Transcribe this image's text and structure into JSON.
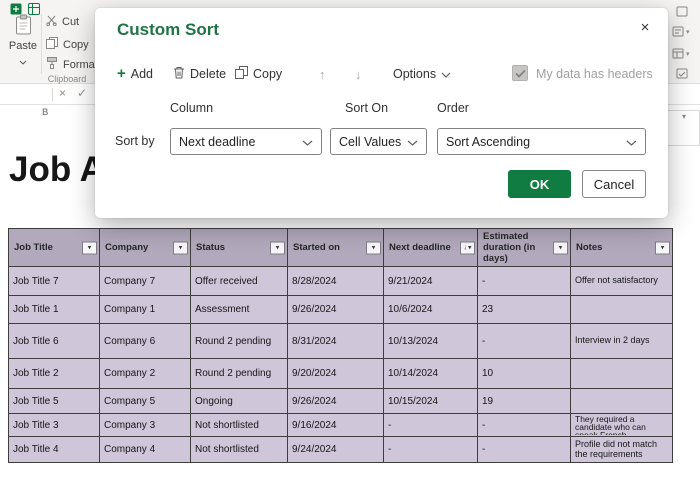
{
  "colors": {
    "accent": "#107c41",
    "title_green": "#217346",
    "header_bg": "#b2a9bc",
    "body_bg": "#cfc6d9",
    "grid": "#3e3e3e",
    "status_offer_bg": "#7aa33f",
    "status_assessment_bg": "#2e9ad5",
    "status_pending_bg": "#e0b62b",
    "status_pending_text": "#9c6500",
    "status_ongoing_text": "#4c8a2e",
    "status_rejected_text": "#c00000"
  },
  "icons": {
    "caret_down": "▾",
    "sort_down_arrow": "↓",
    "close": "×",
    "x_mark": "×",
    "check_mark": "✓",
    "up_arrow": "↑",
    "down_arrow": "↓",
    "plus": "+"
  },
  "ribbon": {
    "paste_label": "Paste",
    "cut_label": "Cut",
    "copy_label": "Copy",
    "format_label": "Format",
    "group_label": "Clipboard"
  },
  "sheet": {
    "title": "Job A",
    "column_letter": "B"
  },
  "dialog": {
    "title": "Custom Sort",
    "toolbar": {
      "add": "Add",
      "delete": "Delete",
      "copy": "Copy",
      "options": "Options",
      "headers_checkbox_label": "My data has headers",
      "headers_checkbox_checked": true
    },
    "labels": {
      "column": "Column",
      "sort_on": "Sort On",
      "order": "Order",
      "sort_by": "Sort by"
    },
    "selects": {
      "column_value": "Next deadline",
      "sort_on_value": "Cell Values",
      "order_value": "Sort Ascending"
    },
    "buttons": {
      "ok": "OK",
      "cancel": "Cancel"
    }
  },
  "table": {
    "columns": [
      {
        "label": "Job Title"
      },
      {
        "label": "Company"
      },
      {
        "label": "Status"
      },
      {
        "label": "Started on"
      },
      {
        "label": "Next deadline",
        "sorted": true
      },
      {
        "label": "Estimated duration (in days)"
      },
      {
        "label": "Notes"
      }
    ],
    "rows": [
      {
        "job_title": "Job Title 7",
        "company": "Company 7",
        "status": "Offer received",
        "started_on": "8/28/2024",
        "next_deadline": "9/21/2024",
        "estimated_duration": "-",
        "notes": "Offer not satisfactory"
      },
      {
        "job_title": "Job Title 1",
        "company": "Company 1",
        "status": "Assessment",
        "started_on": "9/26/2024",
        "next_deadline": "10/6/2024",
        "estimated_duration": "23",
        "notes": ""
      },
      {
        "job_title": "Job Title 6",
        "company": "Company 6",
        "status": "Round 2 pending",
        "started_on": "8/31/2024",
        "next_deadline": "10/13/2024",
        "estimated_duration": "-",
        "notes": "Interview in 2 days"
      },
      {
        "job_title": "Job Title 2",
        "company": "Company 2",
        "status": "Round 2 pending",
        "started_on": "9/20/2024",
        "next_deadline": "10/14/2024",
        "estimated_duration": "10",
        "notes": ""
      },
      {
        "job_title": "Job Title 5",
        "company": "Company 5",
        "status": "Ongoing",
        "started_on": "9/26/2024",
        "next_deadline": "10/15/2024",
        "estimated_duration": "19",
        "notes": ""
      },
      {
        "job_title": "Job Title 3",
        "company": "Company 3",
        "status": "Not shortlisted",
        "started_on": "9/16/2024",
        "next_deadline": "-",
        "estimated_duration": "-",
        "notes": "They required a candidate who can speak French"
      },
      {
        "job_title": "Job Title 4",
        "company": "Company 4",
        "status": "Not shortlisted",
        "started_on": "9/24/2024",
        "next_deadline": "-",
        "estimated_duration": "-",
        "notes": "Profile did not match the requirements"
      }
    ]
  }
}
